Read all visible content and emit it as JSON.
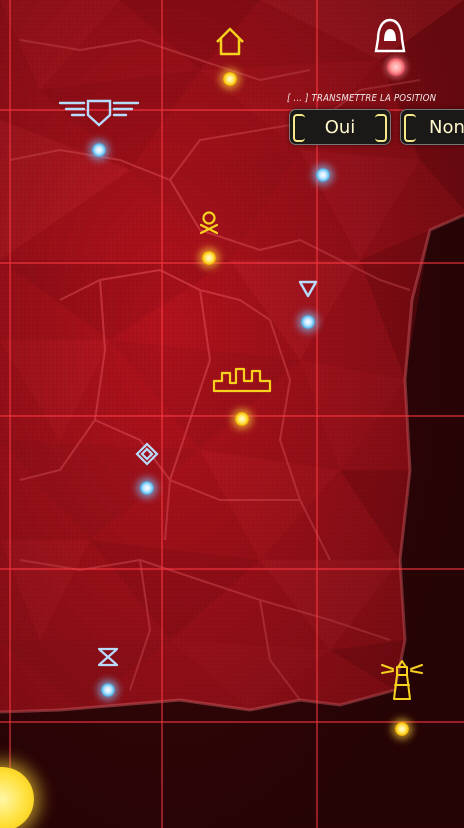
{
  "prompt": {
    "text": "[ ... ] TRANSMETTRE LA POSITION"
  },
  "buttons": {
    "yes_label": "Oui",
    "no_label": "Non"
  },
  "map": {
    "theme_color": "#b3121c",
    "background_color": "#3a0608",
    "grid_color": "#ff3a44",
    "neon_yellow": "#f6d21f",
    "neon_blue": "#b8dcff"
  },
  "icons": [
    "house-icon",
    "hooded-figure-icon",
    "winged-shield-icon",
    "skull-crossbones-icon",
    "triangle-down-icon",
    "castle-icon",
    "diamond-icon",
    "hourglass-icon",
    "lighthouse-icon"
  ]
}
